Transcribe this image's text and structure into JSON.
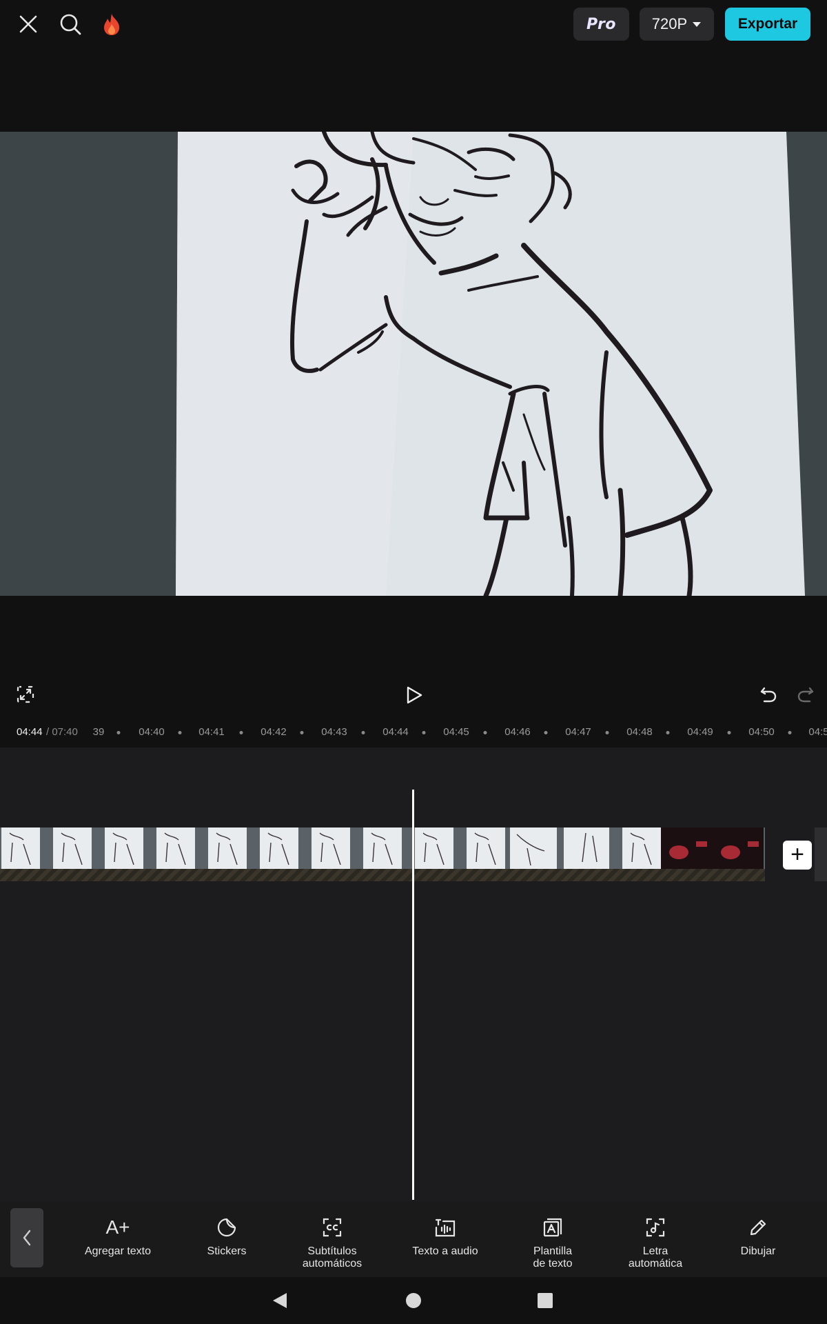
{
  "header": {
    "pro_label": "Pro",
    "resolution_label": "720P",
    "export_label": "Exportar",
    "icons": [
      "close-icon",
      "search-icon",
      "flame-icon"
    ]
  },
  "player": {
    "icons": [
      "fullscreen-icon",
      "play-icon",
      "undo-icon",
      "redo-icon"
    ]
  },
  "timeline": {
    "current_time": "04:44",
    "total_time": "/ 07:40",
    "ticks": [
      "39",
      "04:40",
      "04:41",
      "04:42",
      "04:43",
      "04:44",
      "04:45",
      "04:46",
      "04:47",
      "04:48",
      "04:49",
      "04:50",
      "04:5"
    ],
    "add_clip_label": "+"
  },
  "toolbar": {
    "tools": [
      {
        "label": "Agregar texto",
        "icon": "add-text-icon"
      },
      {
        "label": "Stickers",
        "icon": "sticker-icon"
      },
      {
        "label": "Subtítulos\nautomáticos",
        "icon": "captions-icon"
      },
      {
        "label": "Texto a audio",
        "icon": "text-to-audio-icon"
      },
      {
        "label": "Plantilla\nde texto",
        "icon": "text-template-icon"
      },
      {
        "label": "Letra\nautomática",
        "icon": "auto-lyrics-icon"
      },
      {
        "label": "Dibujar",
        "icon": "pencil-icon"
      }
    ],
    "add_text_glyph": "A+"
  },
  "colors": {
    "accent": "#1ec8e0",
    "background": "#111112",
    "timeline_bg": "#1c1c1e"
  }
}
